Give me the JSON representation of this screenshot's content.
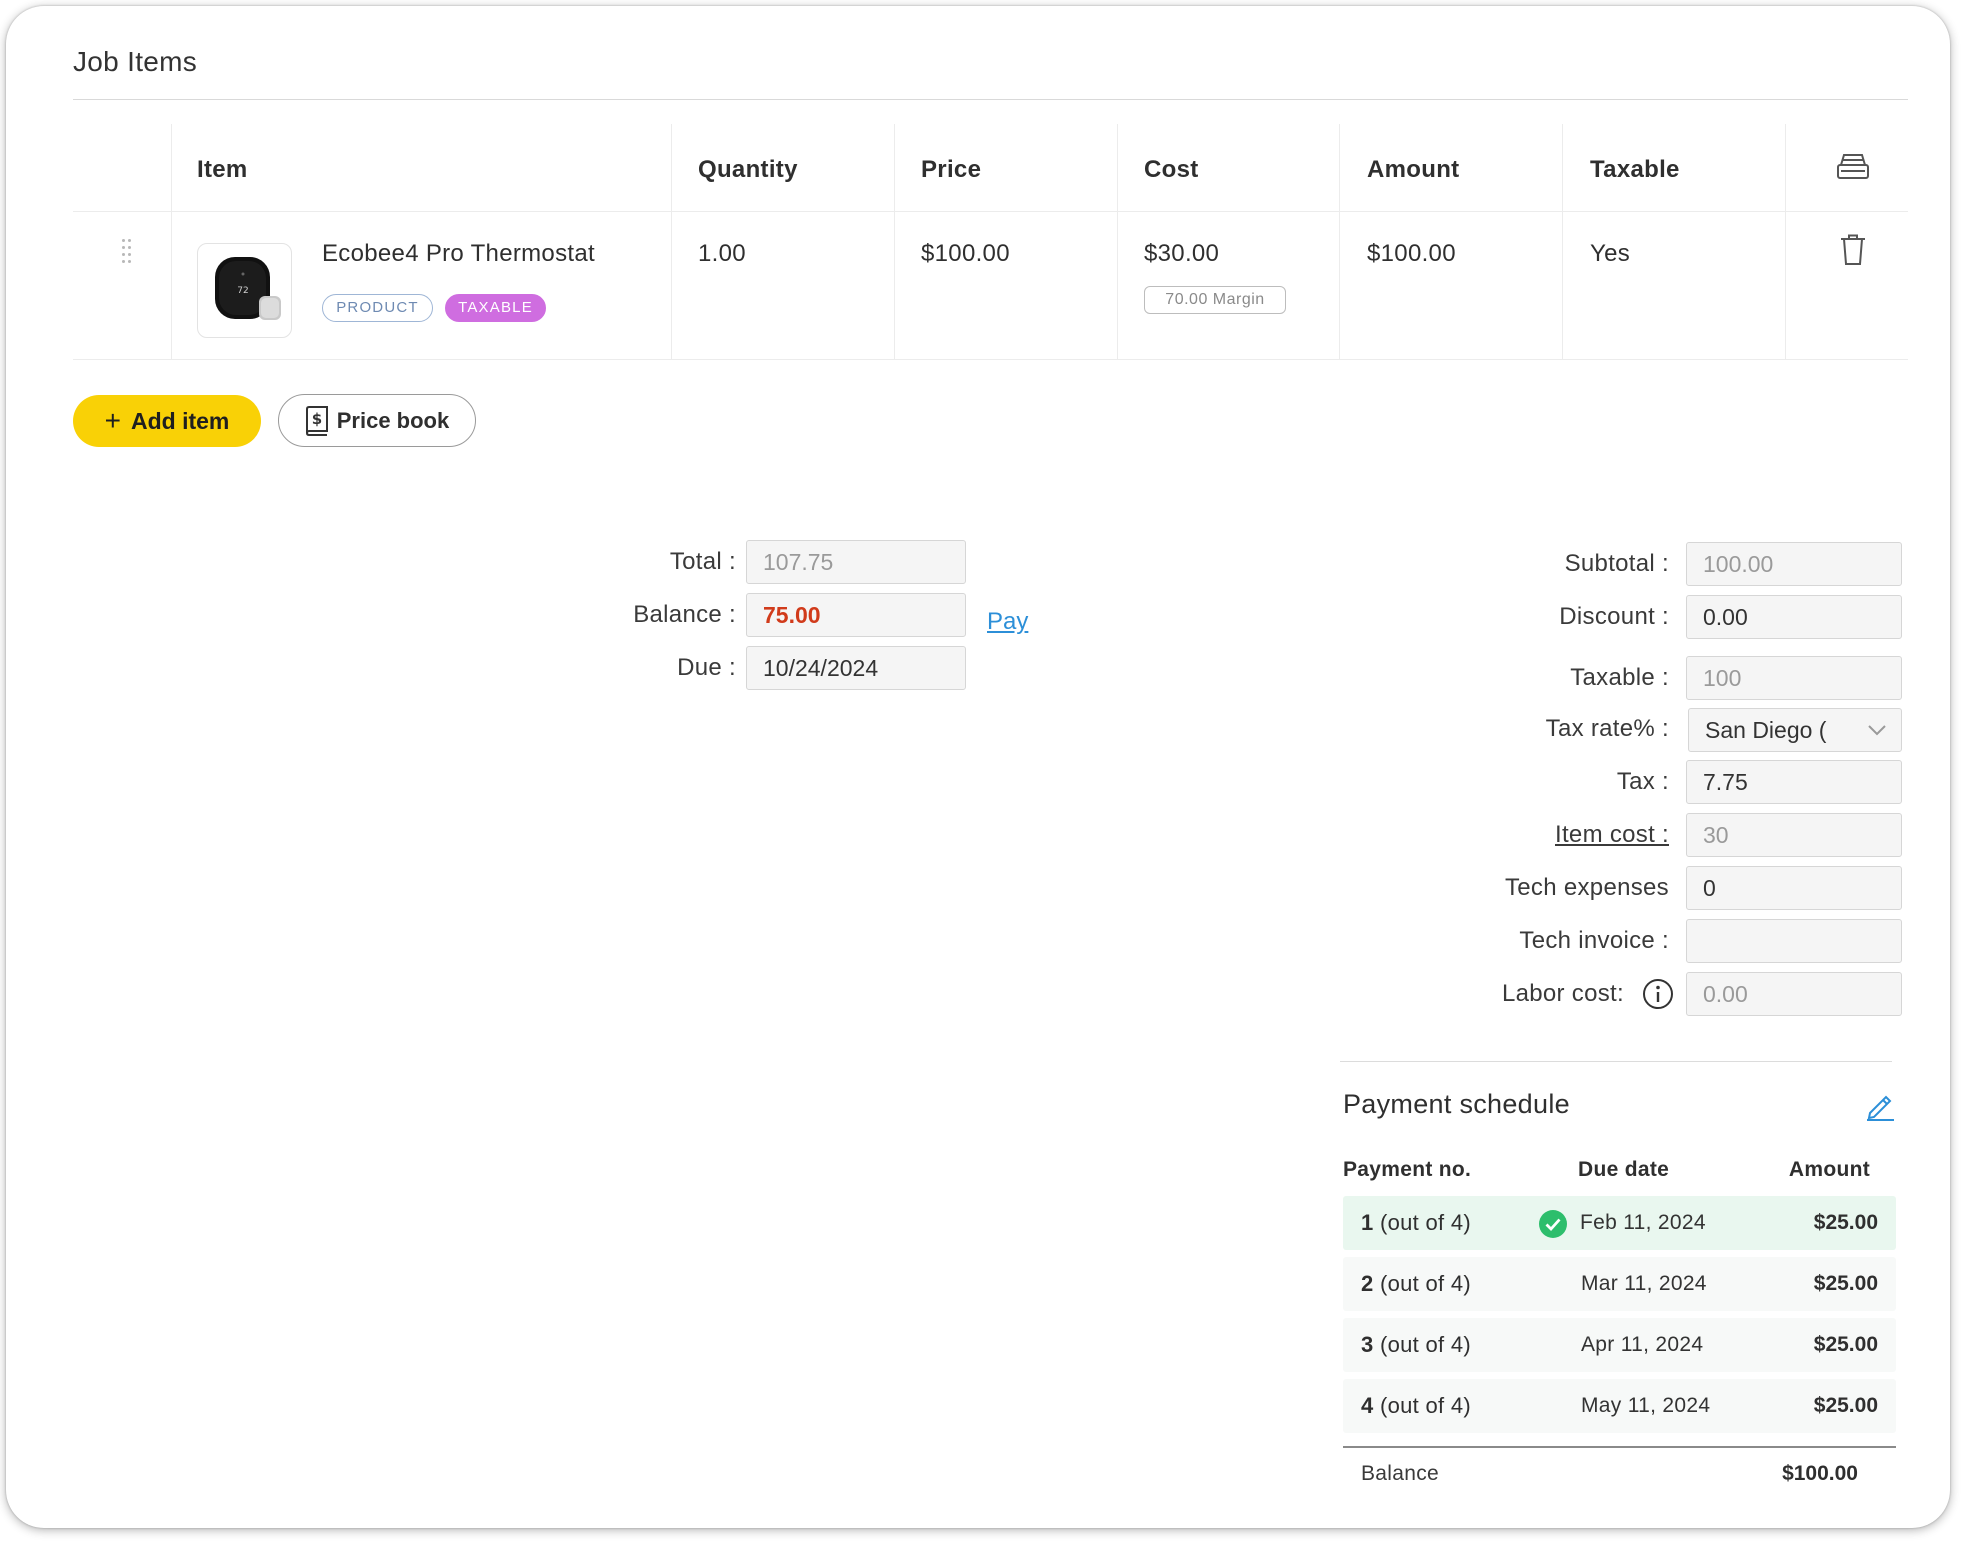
{
  "section_title": "Job Items",
  "table": {
    "headers": {
      "item": "Item",
      "quantity": "Quantity",
      "price": "Price",
      "cost": "Cost",
      "amount": "Amount",
      "taxable": "Taxable"
    },
    "rows": [
      {
        "name": "Ecobee4 Pro Thermostat",
        "badges": {
          "type": "PRODUCT",
          "tax": "TAXABLE"
        },
        "quantity": "1.00",
        "price": "$100.00",
        "cost": "$30.00",
        "margin": "70.00 Margin",
        "amount": "$100.00",
        "taxable": "Yes",
        "thumbnail_screen_text": "72"
      }
    ]
  },
  "buttons": {
    "add_item": "Add item",
    "price_book": "Price book"
  },
  "totals_left": {
    "total_label": "Total :",
    "total_value": "107.75",
    "balance_label": "Balance :",
    "balance_value": "75.00",
    "due_label": "Due :",
    "due_value": "10/24/2024",
    "pay_link": "Pay"
  },
  "totals_right": {
    "subtotal_label": "Subtotal :",
    "subtotal_value": "100.00",
    "discount_label": "Discount :",
    "discount_value": "0.00",
    "taxable_label": "Taxable :",
    "taxable_value": "100",
    "tax_rate_label": "Tax rate% :",
    "tax_rate_value": "San Diego (",
    "tax_label": "Tax :",
    "tax_value": "7.75",
    "item_cost_label": "Item cost :",
    "item_cost_value": "30",
    "tech_expenses_label": "Tech expenses",
    "tech_expenses_value": "0",
    "tech_invoice_label": "Tech invoice :",
    "tech_invoice_value": "",
    "labor_cost_label": "Labor cost:",
    "labor_cost_value": "0.00"
  },
  "payment_schedule": {
    "title": "Payment schedule",
    "headers": {
      "no": "Payment no.",
      "due": "Due date",
      "amount": "Amount"
    },
    "rows": [
      {
        "num": "1",
        "suffix": "(out of 4)",
        "date": "Feb 11, 2024",
        "amount": "$25.00",
        "paid": true
      },
      {
        "num": "2",
        "suffix": "(out of 4)",
        "date": "Mar 11, 2024",
        "amount": "$25.00",
        "paid": false
      },
      {
        "num": "3",
        "suffix": "(out of 4)",
        "date": "Apr 11, 2024",
        "amount": "$25.00",
        "paid": false
      },
      {
        "num": "4",
        "suffix": "(out of 4)",
        "date": "May 11, 2024",
        "amount": "$25.00",
        "paid": false
      }
    ],
    "balance_label": "Balance",
    "balance_value": "$100.00"
  },
  "colors": {
    "accent_yellow": "#f9d106",
    "link_blue": "#2c8fd8",
    "balance_red": "#d13b1b",
    "taxable_badge": "#cf6de0",
    "paid_green": "#2dbe6c"
  }
}
